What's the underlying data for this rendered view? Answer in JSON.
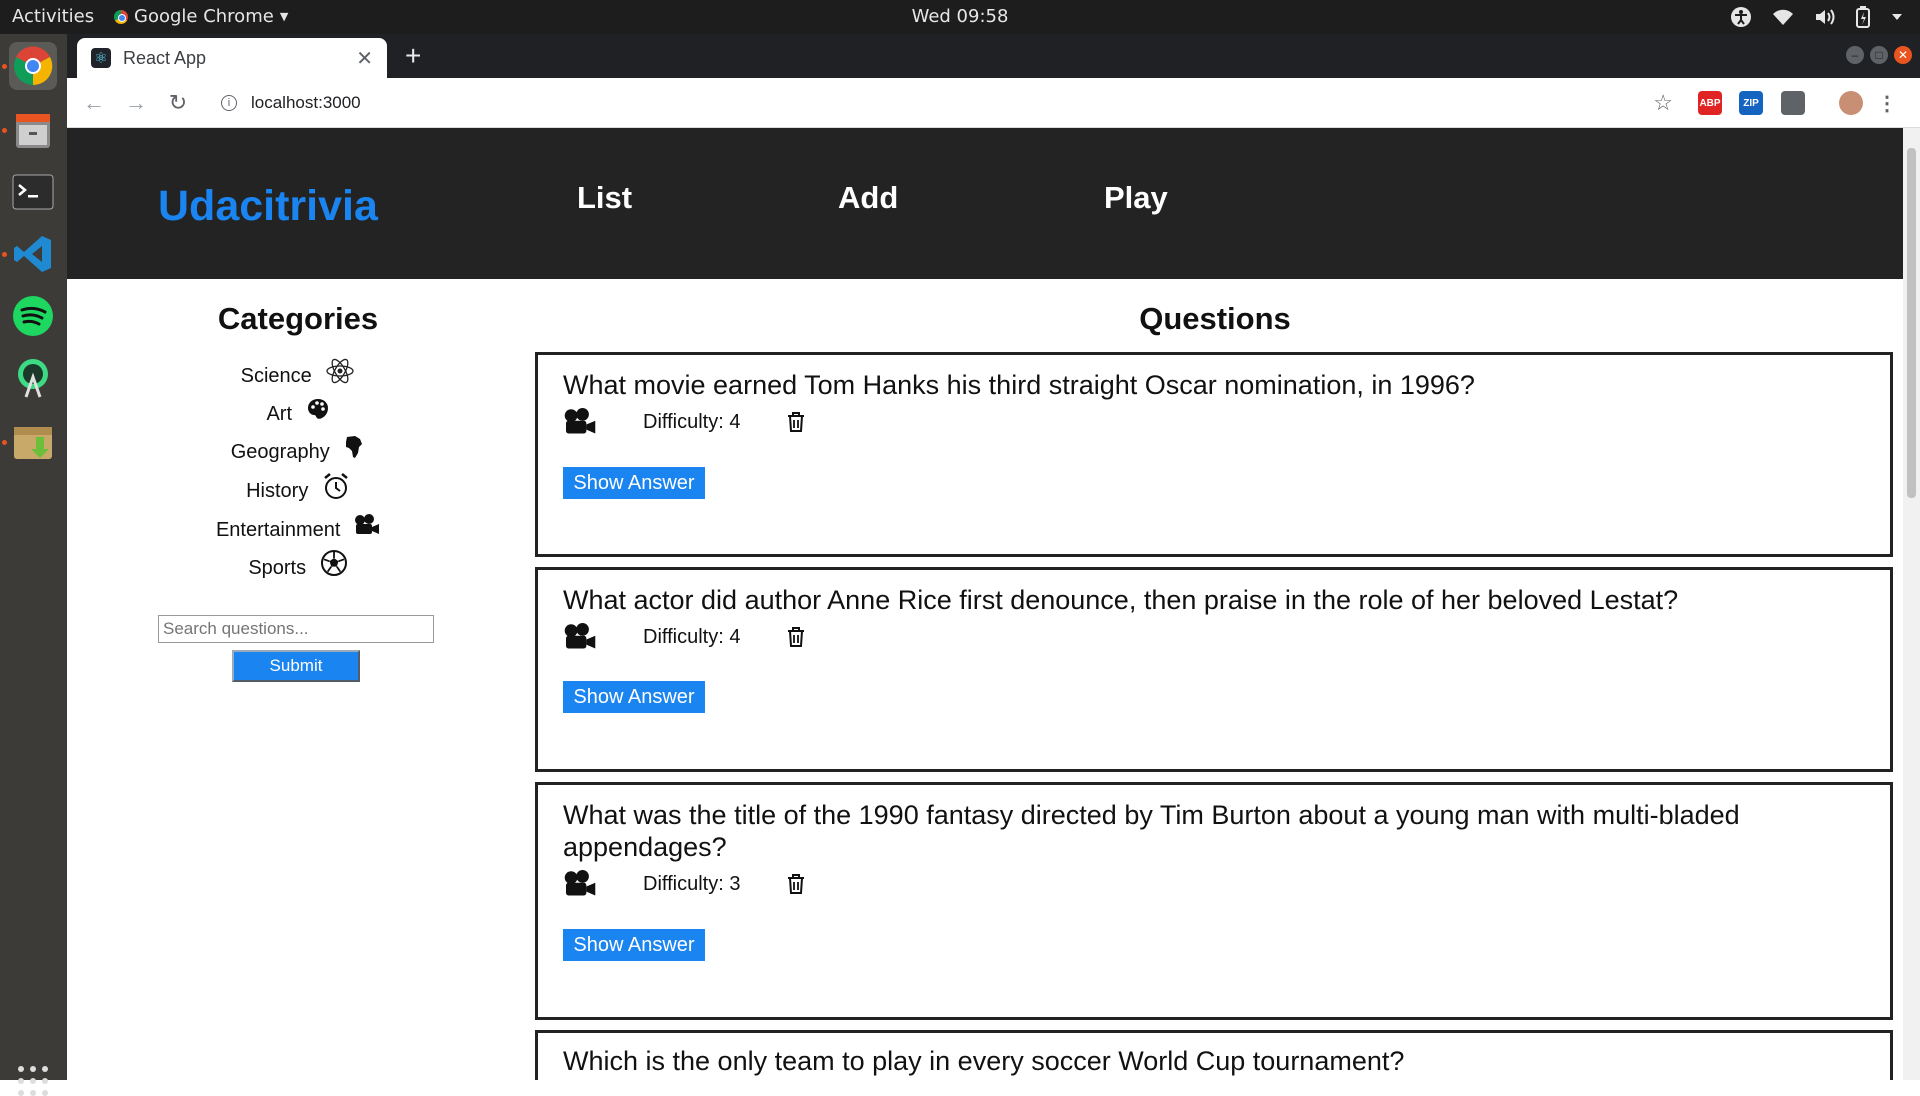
{
  "system_bar": {
    "activities": "Activities",
    "app_name": "Google Chrome",
    "clock": "Wed 09:58"
  },
  "browser": {
    "tab_title": "React App",
    "url": "localhost:3000",
    "extensions": [
      {
        "name": "adblock-icon",
        "label": "ABP",
        "color": "#e02424"
      },
      {
        "name": "zip-extension-icon",
        "label": "ZIP",
        "color": "#1565c0"
      },
      {
        "name": "extension-icon",
        "label": "",
        "color": "#5f6368"
      }
    ]
  },
  "app": {
    "brand": "Udacitrivia",
    "nav": [
      "List",
      "Add",
      "Play"
    ],
    "categories_heading": "Categories",
    "categories": [
      {
        "label": "Science",
        "icon": "science-icon"
      },
      {
        "label": "Art",
        "icon": "art-icon"
      },
      {
        "label": "Geography",
        "icon": "geography-icon"
      },
      {
        "label": "History",
        "icon": "history-icon"
      },
      {
        "label": "Entertainment",
        "icon": "entertainment-icon"
      },
      {
        "label": "Sports",
        "icon": "sports-icon"
      }
    ],
    "search_placeholder": "Search questions...",
    "submit_label": "Submit",
    "questions_heading": "Questions",
    "show_answer_label": "Show Answer",
    "questions": [
      {
        "text": "What movie earned Tom Hanks his third straight Oscar nomination, in 1996?",
        "difficulty": "Difficulty: 4",
        "category_icon": "entertainment-icon"
      },
      {
        "text": "What actor did author Anne Rice first denounce, then praise in the role of her beloved Lestat?",
        "difficulty": "Difficulty: 4",
        "category_icon": "entertainment-icon"
      },
      {
        "text": "What was the title of the 1990 fantasy directed by Tim Burton about a young man with multi-bladed appendages?",
        "difficulty": "Difficulty: 3",
        "category_icon": "entertainment-icon"
      },
      {
        "text": "Which is the only team to play in every soccer World Cup tournament?",
        "difficulty": "",
        "category_icon": "sports-icon"
      }
    ]
  },
  "colors": {
    "brand_blue": "#1a84f0",
    "header_bg": "#232323"
  }
}
